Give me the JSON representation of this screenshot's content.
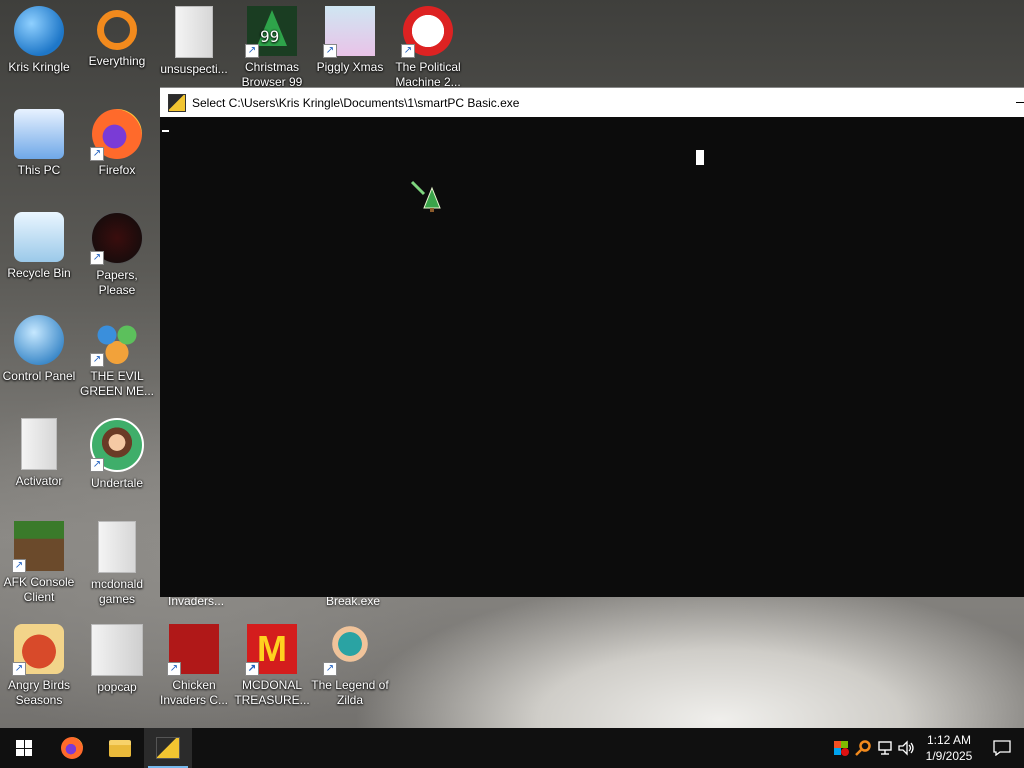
{
  "desktop": {
    "icons": [
      {
        "label": "Kris Kringle",
        "icon": "user-folder-icon",
        "shortcut": false
      },
      {
        "label": "Everything",
        "icon": "everything-search-icon",
        "shortcut": true
      },
      {
        "label": "unsuspecti...",
        "icon": "file-icon",
        "shortcut": false
      },
      {
        "label": "Christmas Browser 99",
        "icon": "christmas-tree-icon",
        "shortcut": true
      },
      {
        "label": "Piggly Xmas",
        "icon": "piggly-icon",
        "shortcut": true
      },
      {
        "label": "The Political Machine 2...",
        "icon": "political-icon",
        "shortcut": true
      },
      {
        "label": "This PC",
        "icon": "computer-icon",
        "shortcut": false
      },
      {
        "label": "Firefox",
        "icon": "firefox-icon",
        "shortcut": true
      },
      {
        "label": "Recycle Bin",
        "icon": "recycle-bin-icon",
        "shortcut": false
      },
      {
        "label": "Papers, Please",
        "icon": "papers-please-icon",
        "shortcut": true
      },
      {
        "label": "Control Panel",
        "icon": "control-panel-icon",
        "shortcut": false
      },
      {
        "label": "THE EVIL GREEN ME...",
        "icon": "messenger-icon",
        "shortcut": true
      },
      {
        "label": "Activator",
        "icon": "file-icon",
        "shortcut": false
      },
      {
        "label": "Undertale",
        "icon": "undertale-icon",
        "shortcut": true
      },
      {
        "label": "AFK Console Client",
        "icon": "minecraft-block-icon",
        "shortcut": true
      },
      {
        "label": "mcdonald games",
        "icon": "folder-icon",
        "shortcut": false
      },
      {
        "label": "Angry Birds Seasons",
        "icon": "angry-birds-icon",
        "shortcut": true
      },
      {
        "label": "popcap",
        "icon": "folder-icon",
        "shortcut": false
      },
      {
        "label": "Chicken Invaders C...",
        "icon": "chicken-invaders-icon",
        "shortcut": true
      },
      {
        "label": "MCDONAL TREASURE...",
        "icon": "mcdonalds-icon",
        "shortcut": true
      },
      {
        "label": "The Legend of Zilda",
        "icon": "zilda-icon",
        "shortcut": true
      }
    ],
    "peek_labels": [
      "Invaders...",
      "Break.exe"
    ]
  },
  "window": {
    "title": "Select C:\\Users\\Kris Kringle\\Documents\\1\\smartPC Basic.exe",
    "background": "#0c0c0c"
  },
  "taskbar": {
    "apps": [
      {
        "name": "start",
        "icon": "windows-icon"
      },
      {
        "name": "firefox",
        "icon": "firefox-icon"
      },
      {
        "name": "file-explorer",
        "icon": "folder-icon"
      },
      {
        "name": "smartpc-basic",
        "icon": "console-app-icon",
        "active": true
      }
    ],
    "tray": {
      "time": "1:12 AM",
      "date": "1/9/2025"
    }
  }
}
